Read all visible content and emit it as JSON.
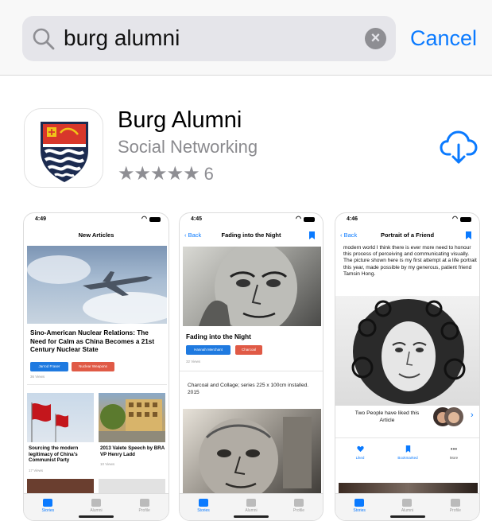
{
  "search": {
    "query": "burg alumni",
    "cancel_label": "Cancel"
  },
  "app": {
    "name": "Burg Alumni",
    "category": "Social Networking",
    "rating_stars": 5,
    "rating_count": "6",
    "icons": [
      "search-icon",
      "clear-icon",
      "cloud-download-icon"
    ]
  },
  "screenshots": [
    {
      "time": "4:49",
      "nav_title": "New Articles",
      "headline": "Sino-American Nuclear Relations: The Need for Calm as China Becomes a 21st Century Nuclear State",
      "tags": [
        "Jarrod Fraser",
        "Nuclear Weapons"
      ],
      "views": "36 Views",
      "items": [
        {
          "caption": "Sourcing the modern legitimacy of China's Communist Party",
          "views": "17 Views"
        },
        {
          "caption": "2013 Valete Speech by BRA VP Henry Ladd",
          "views": "10 Views"
        }
      ],
      "tabs": [
        "Stories",
        "Alumni",
        "Profile"
      ]
    },
    {
      "time": "4:45",
      "back_label": "Back",
      "nav_title": "Fading into the Night",
      "title": "Fading into the Night",
      "tags": [
        "Hannah Merchant",
        "Charcoal"
      ],
      "views": "32 Views",
      "description": "Charcoal and Collage; series 225 x 100cm installed. 2015",
      "tabs": [
        "Stories",
        "Alumni",
        "Profile"
      ]
    },
    {
      "time": "4:46",
      "back_label": "Back",
      "nav_title": "Portrait of a Friend",
      "body": "modern world I think there is ever more need to honour this process of perceiving and communicating visually. The picture shown here is my first attempt at a life portrait this year, made possible by my generous, patient friend Tamsin Hong.",
      "liked_text": "Two People have liked this Article",
      "actions": [
        "Liked",
        "Bookmarked",
        "More"
      ],
      "tabs": [
        "Stories",
        "Alumni",
        "Profile"
      ]
    }
  ],
  "colors": {
    "accent": "#0a7aff",
    "tag_blue": "#1f7ae0",
    "tag_red": "#e05a46",
    "icon_red": "#d8372b",
    "icon_navy": "#1c2b50"
  }
}
